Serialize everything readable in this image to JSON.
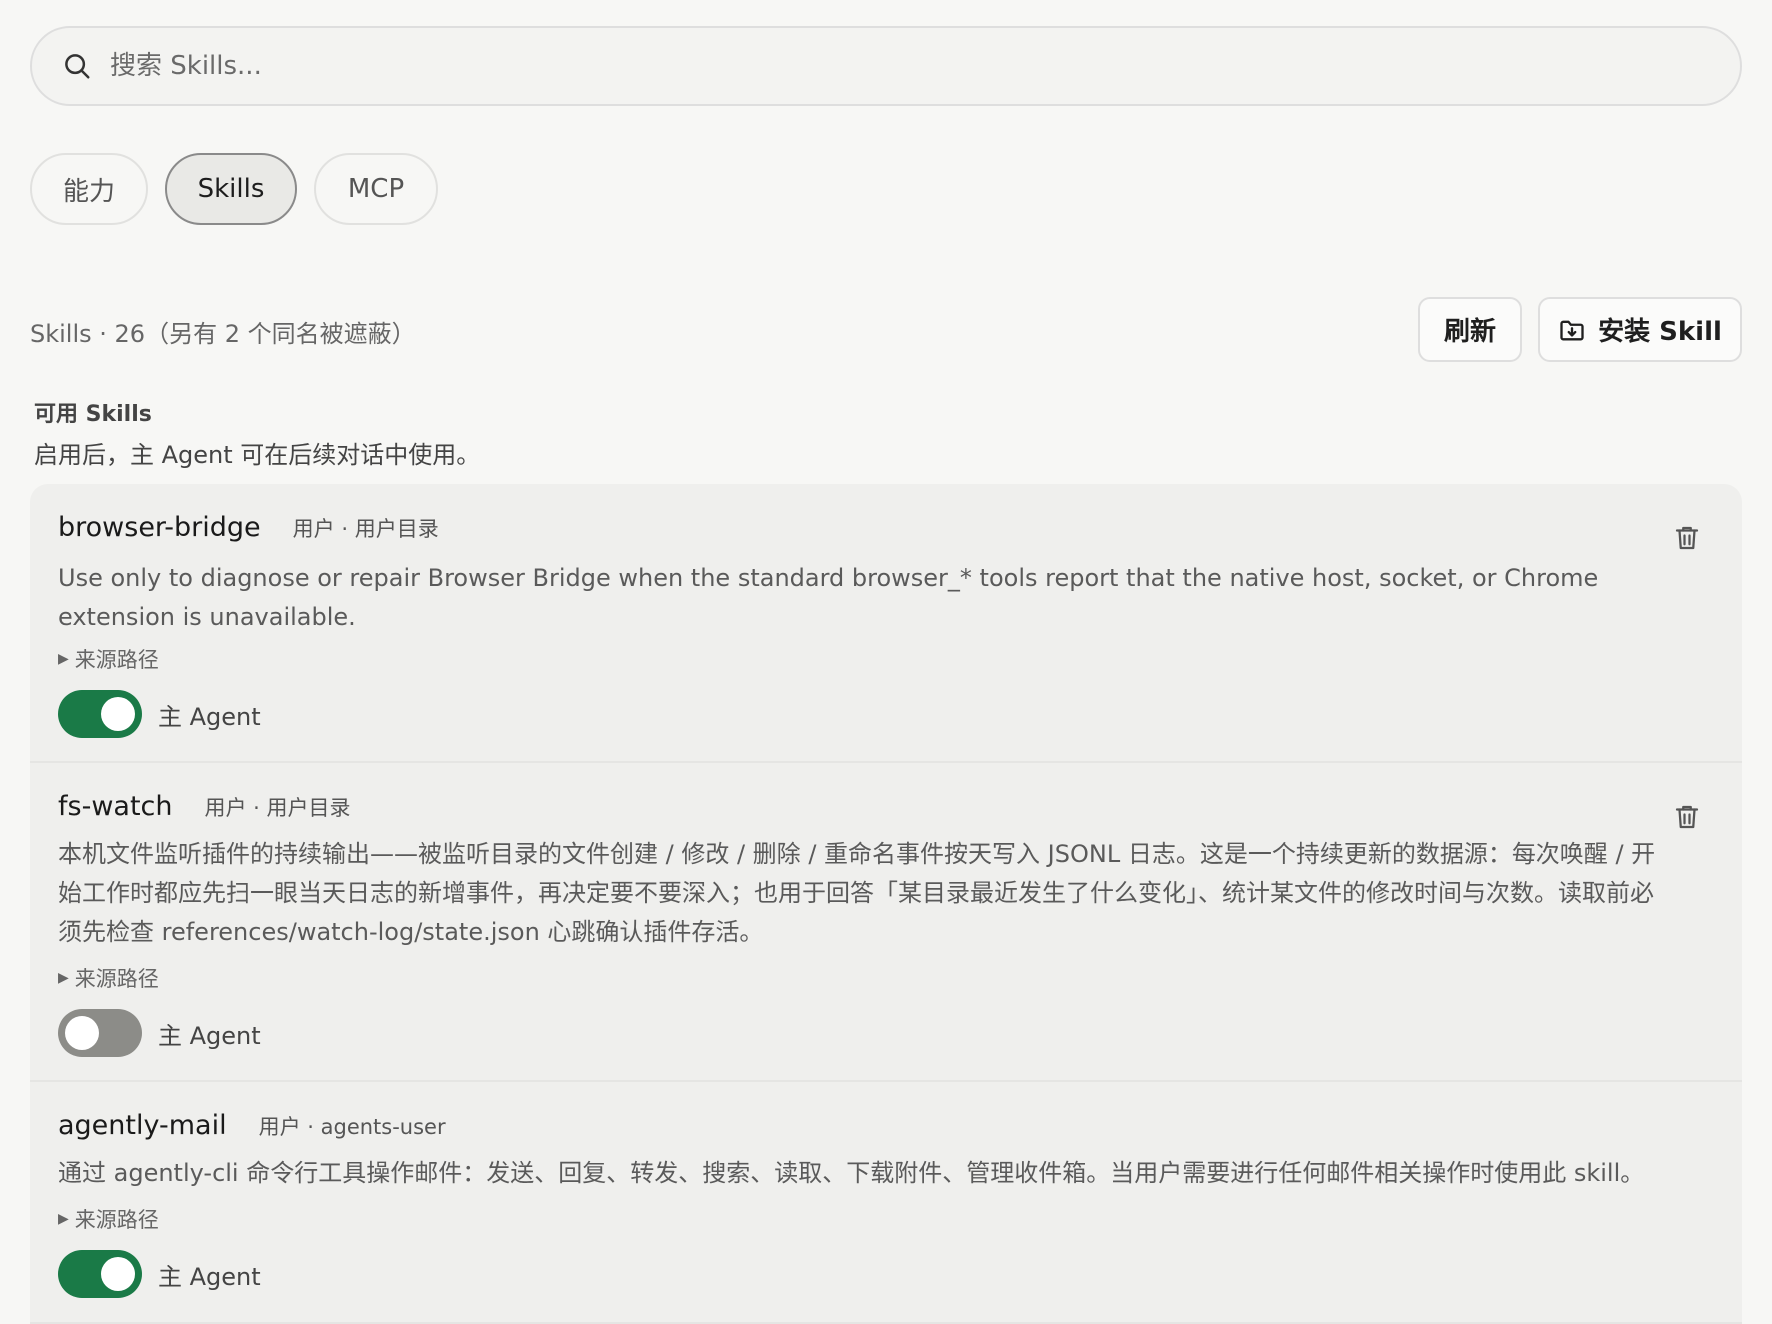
{
  "search": {
    "placeholder": "搜索 Skills..."
  },
  "tabs": [
    {
      "label": "能力"
    },
    {
      "label": "Skills",
      "active": true
    },
    {
      "label": "MCP"
    }
  ],
  "summary": "Skills · 26（另有 2 个同名被遮蔽）",
  "actions": {
    "refresh_label": "刷新",
    "install_label": "安装 Skill"
  },
  "section": {
    "title": "可用 Skills",
    "description": "启用后，主 Agent 可在后续对话中使用。"
  },
  "skills": [
    {
      "name": "browser-bridge",
      "meta": "用户 · 用户目录",
      "description": "Use only to diagnose or repair Browser Bridge when the standard browser_* tools report that the native host, socket, or Chrome extension is unavailable.",
      "source_label": "来源路径",
      "toggle_label": "主 Agent",
      "enabled": true
    },
    {
      "name": "fs-watch",
      "meta": "用户 · 用户目录",
      "description": "本机文件监听插件的持续输出——被监听目录的文件创建 / 修改 / 删除 / 重命名事件按天写入 JSONL 日志。这是一个持续更新的数据源：每次唤醒 / 开始工作时都应先扫一眼当天日志的新增事件，再决定要不要深入；也用于回答「某目录最近发生了什么变化」、统计某文件的修改时间与次数。读取前必须先检查 references/watch-log/state.json 心跳确认插件存活。",
      "source_label": "来源路径",
      "toggle_label": "主 Agent",
      "enabled": false
    },
    {
      "name": "agently-mail",
      "meta": "用户 · agents-user",
      "description": "通过 agently-cli 命令行工具操作邮件：发送、回复、转发、搜索、读取、下载附件、管理收件箱。当用户需要进行任何邮件相关操作时使用此 skill。",
      "source_label": "来源路径",
      "toggle_label": "主 Agent",
      "enabled": true
    }
  ],
  "colors": {
    "toggle_on": "#1a7a47",
    "toggle_off": "#8c8c88",
    "background": "#f7f7f5",
    "card": "#efefed"
  },
  "icons": {
    "search": "search-icon",
    "install": "folder-download-icon",
    "delete": "trash-icon",
    "expand": "triangle-right-icon"
  }
}
